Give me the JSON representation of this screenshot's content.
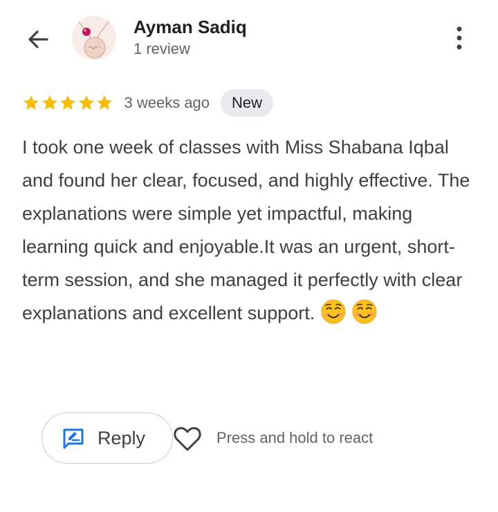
{
  "header": {
    "back_icon": "arrow-left-icon",
    "author_name": "Ayman Sadiq",
    "review_count": "1 review",
    "more_icon": "more-vertical-icon"
  },
  "review": {
    "rating": 5,
    "rating_max": 5,
    "time": "3 weeks ago",
    "badge": "New",
    "text": "I took one week of classes with Miss Shabana Iqbal and found her clear, focused, and highly effective. The explanations were simple yet impactful, making learning quick and enjoyable.It was an urgent, short-term session, and she managed it perfectly with clear explanations and excellent support.",
    "emoji_count": 2
  },
  "actions": {
    "reply_label": "Reply",
    "react_hint": "Press and hold to react",
    "reply_icon": "reply-edit-icon",
    "heart_icon": "heart-outline-icon"
  },
  "colors": {
    "star": "#fbbc04",
    "reply_icon": "#1a73e8",
    "badge_bg": "#e8eaed",
    "muted_text": "#5f6368"
  }
}
